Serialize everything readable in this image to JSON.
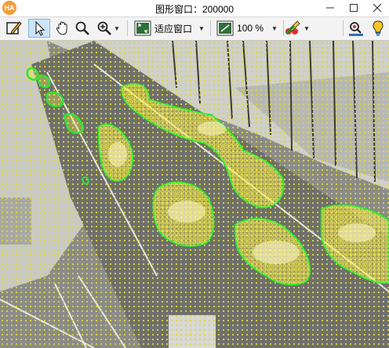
{
  "window": {
    "title": "图形窗口：200000",
    "logo_text": "HA"
  },
  "toolbar": {
    "fit_label": "适应窗口",
    "zoom_label": "100 %"
  },
  "icons": [
    "pencil-icon",
    "arrow-cursor-icon",
    "hand-icon",
    "magnifier-icon",
    "zoom-in-icon",
    "fit-window-icon",
    "zoom-percent-icon",
    "color-paint-icon",
    "inspect-icon",
    "lightbulb-icon",
    "minimize-icon",
    "maximize-icon",
    "close-icon"
  ],
  "colors": {
    "region_outline": "#2fe52f",
    "region_fill": "#f5f24a",
    "point_marks": "#d9d93a",
    "toolbar_bg": "#f3f3f3"
  }
}
